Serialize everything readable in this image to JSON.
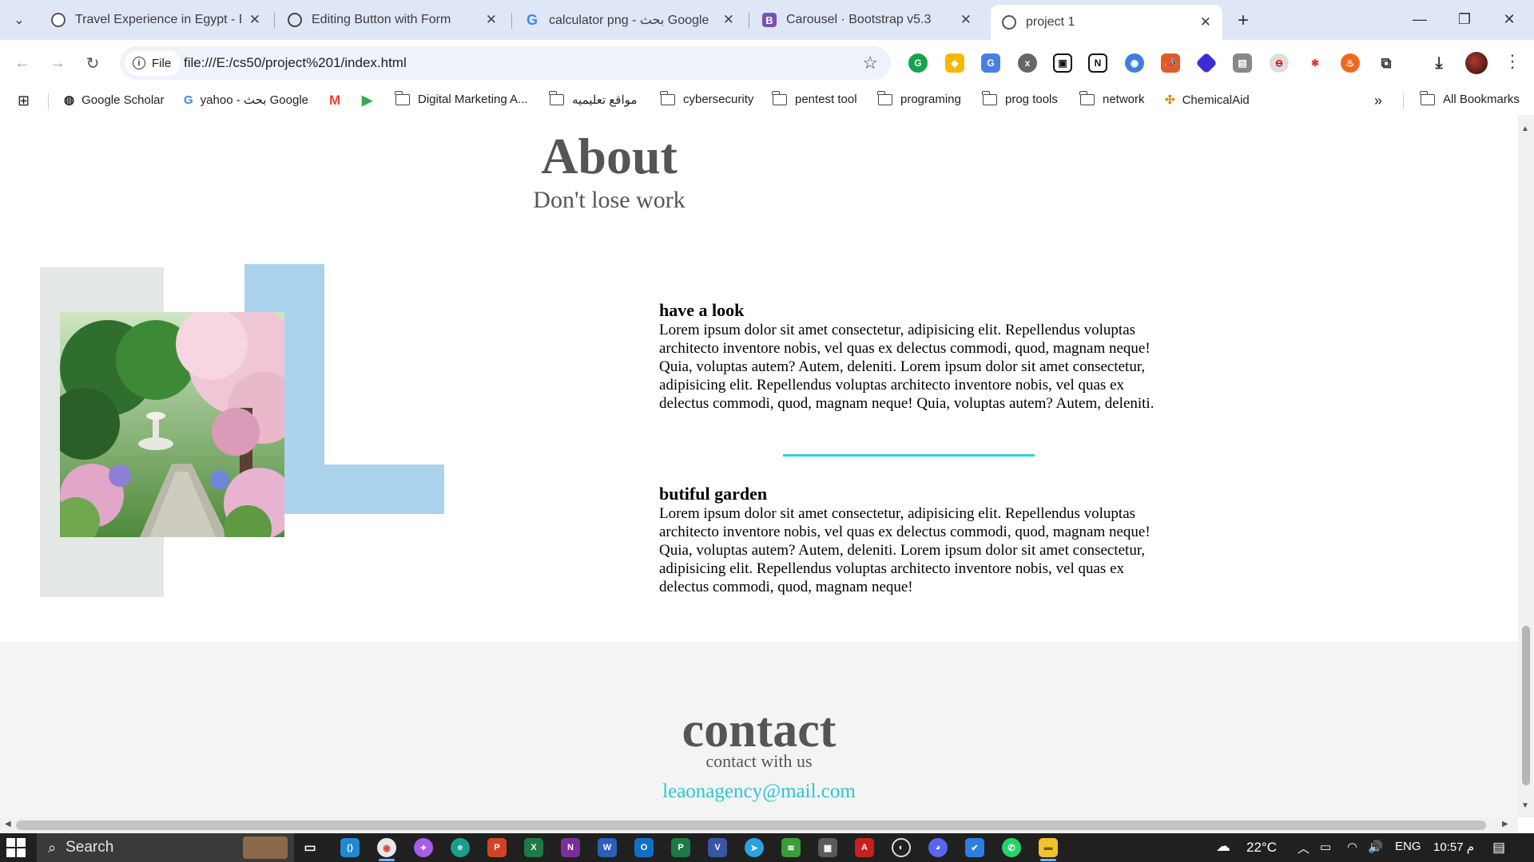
{
  "browser": {
    "tabs": [
      {
        "title": "Travel Experience in Egypt - Blo",
        "favicon": "globe-icon"
      },
      {
        "title": "Editing Button with Form",
        "favicon": "chatgpt-icon"
      },
      {
        "title": "calculator png - بحث Google",
        "favicon": "google-icon"
      },
      {
        "title": "Carousel · Bootstrap v5.3",
        "favicon": "bootstrap-icon"
      },
      {
        "title": "project 1",
        "favicon": "globe-icon",
        "active": true
      }
    ],
    "new_tab_label": "+",
    "site_chip_label": "File",
    "url": "file:///E:/cs50/project%201/index.html",
    "bookmarks": [
      {
        "label": "Google Scholar",
        "type": "site"
      },
      {
        "label": "yahoo - بحث Google",
        "type": "site"
      },
      {
        "label": "Digital Marketing A...",
        "type": "folder"
      },
      {
        "label": "مواقع تعليميه",
        "type": "folder"
      },
      {
        "label": "cybersecurity",
        "type": "folder"
      },
      {
        "label": "pentest tool",
        "type": "folder"
      },
      {
        "label": "programing",
        "type": "folder"
      },
      {
        "label": "prog tools",
        "type": "folder"
      },
      {
        "label": "network",
        "type": "folder"
      },
      {
        "label": "ChemicalAid",
        "type": "site"
      }
    ],
    "all_bookmarks_label": "All Bookmarks"
  },
  "page": {
    "about_title": "About",
    "about_subtitle": "Don't lose work",
    "section1_heading": "have a look",
    "section1_text": "Lorem ipsum dolor sit amet consectetur, adipisicing elit. Repellendus voluptas architecto inventore nobis, vel quas ex delectus commodi, quod, magnam neque! Quia, voluptas autem? Autem, deleniti. Lorem ipsum dolor sit amet consectetur, adipisicing elit. Repellendus voluptas architecto inventore nobis, vel quas ex delectus commodi, quod, magnam neque! Quia, voluptas autem? Autem, deleniti.",
    "section2_heading": "butiful garden",
    "section2_text": "Lorem ipsum dolor sit amet consectetur, adipisicing elit. Repellendus voluptas architecto inventore nobis, vel quas ex delectus commodi, quod, magnam neque! Quia, voluptas autem? Autem, deleniti. Lorem ipsum dolor sit amet consectetur, adipisicing elit. Repellendus voluptas architecto inventore nobis, vel quas ex delectus commodi, quod, magnam neque!",
    "contact_title": "contact",
    "contact_subtitle": "contact with us",
    "contact_email": "leaonagency@mail.com",
    "colors": {
      "heading": "#555555",
      "accent": "#29d3e6",
      "deco_blue": "#acd3ed",
      "deco_gray": "#e3e7e6"
    }
  },
  "taskbar": {
    "search_label": "Search",
    "weather_temp": "22°C",
    "language": "ENG",
    "time": "10:57 م"
  }
}
